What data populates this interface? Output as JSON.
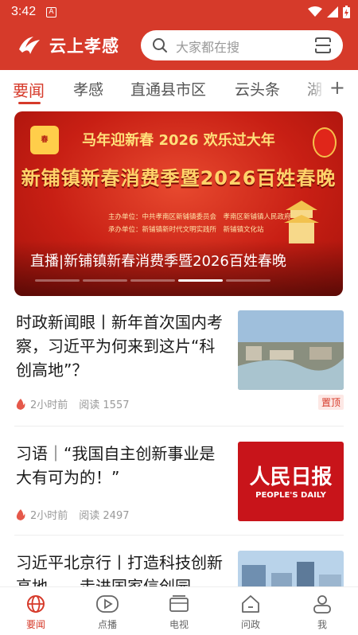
{
  "status_bar": {
    "time": "3:42"
  },
  "header": {
    "brand": "云上孝感",
    "search_placeholder": "大家都在搜",
    "accent": "#d63a2a"
  },
  "tabs": [
    {
      "label": "要闻",
      "active": true
    },
    {
      "label": "孝感"
    },
    {
      "label": "直通县市区"
    },
    {
      "label": "云头条"
    },
    {
      "label": "湖"
    }
  ],
  "banner": {
    "headline": "马年迎新春 2026 欢乐过大年",
    "big_title": "新铺镇新春消费季暨2026百姓春晚",
    "organizer": "主办单位：中共孝南区新铺镇委员会　孝南区新铺镇人民政府",
    "co_organizer": "承办单位：新铺镇新时代文明实践所　新铺镇文化站",
    "caption": "直播|新铺镇新春消费季暨2026百姓春晚",
    "slides": 5,
    "active_slide": 5
  },
  "news": [
    {
      "title": "时政新闻眼丨新年首次国内考察，习近平为何来到这片“科创高地”？",
      "time": "2小时前",
      "reads": "阅读 1557",
      "pinned": "置顶"
    },
    {
      "title": "习语｜“我国自主创新事业是大有可为的！”",
      "time": "2小时前",
      "reads": "阅读 2497",
      "thumb_logo": "人民日报",
      "thumb_logo_en": "PEOPLE'S DAILY"
    },
    {
      "title": "习近平北京行丨打造科技创新高地——走进国家信创园"
    }
  ],
  "bottom_nav": [
    {
      "label": "要闻",
      "icon": "globe-icon",
      "active": true
    },
    {
      "label": "点播",
      "icon": "video-icon"
    },
    {
      "label": "电视",
      "icon": "tv-icon"
    },
    {
      "label": "问政",
      "icon": "house-icon"
    },
    {
      "label": "我",
      "icon": "person-icon"
    }
  ]
}
